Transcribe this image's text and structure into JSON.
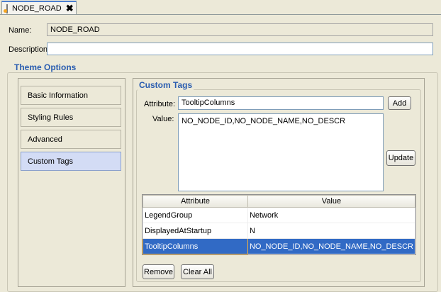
{
  "tab": {
    "title": "NODE_ROAD",
    "close": "✖"
  },
  "form": {
    "name_label": "Name:",
    "name_value": "NODE_ROAD",
    "description_label": "Description:",
    "description_value": ""
  },
  "theme_options": {
    "title": "Theme Options",
    "nav": [
      {
        "label": "Basic Information"
      },
      {
        "label": "Styling Rules"
      },
      {
        "label": "Advanced"
      },
      {
        "label": "Custom Tags",
        "selected": true
      }
    ]
  },
  "custom_tags": {
    "title": "Custom Tags",
    "attribute_label": "Attribute:",
    "attribute_value": "TooltipColumns",
    "add": "Add",
    "value_label": "Value:",
    "value_text": "NO_NODE_ID,NO_NODE_NAME,NO_DESCR",
    "update": "Update",
    "table": {
      "headers": [
        "Attribute",
        "Value"
      ],
      "rows": [
        [
          "LegendGroup",
          "Network"
        ],
        [
          "DisplayedAtStartup",
          "N"
        ],
        [
          "TooltipColumns",
          "NO_NODE_ID,NO_NODE_NAME,NO_DESCR"
        ]
      ],
      "selected_row": 2
    },
    "remove": "Remove",
    "clear_all": "Clear All"
  }
}
